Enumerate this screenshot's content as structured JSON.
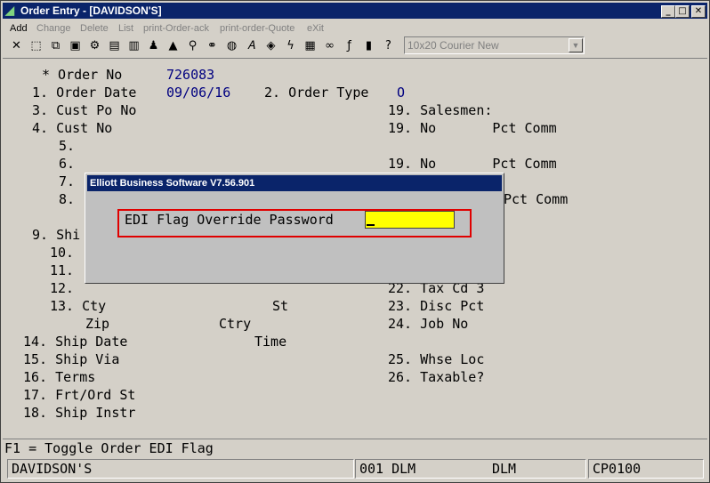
{
  "window": {
    "title": "Order Entry - [DAVIDSON'S]",
    "controls": {
      "minimize": "_",
      "maximize": "□",
      "close": "✕"
    }
  },
  "menu": [
    {
      "label": "Add",
      "enabled": true
    },
    {
      "label": "Change",
      "enabled": false
    },
    {
      "label": "Delete",
      "enabled": false
    },
    {
      "label": "List",
      "enabled": false
    },
    {
      "label": "print-Order-ack",
      "enabled": false
    },
    {
      "label": "print-order-Quote",
      "enabled": false
    },
    {
      "label": "eXit",
      "enabled": false
    }
  ],
  "toolbar": {
    "icons": [
      "close-icon",
      "select-icon",
      "copy-icon",
      "paste-icon",
      "gear-icon",
      "settings-icon",
      "note-icon",
      "user-icon",
      "alert-icon",
      "search-icon",
      "binoculars-icon",
      "globe-icon",
      "font-icon",
      "macro-icon",
      "lightning-icon",
      "calculator-icon",
      "link-icon",
      "function-icon",
      "report-icon",
      "help-icon"
    ],
    "font_select": "10x20 Courier New"
  },
  "form": {
    "order_no_label": "* Order No",
    "order_no_value": "726083",
    "order_date_label": "1. Order Date",
    "order_date_value": "09/06/16",
    "order_type_label": "2. Order Type",
    "order_type_value": "O",
    "cust_po_label": "3. Cust Po No",
    "cust_no_label": "4. Cust No",
    "f5": "5.",
    "f6": "6.",
    "f7": "7.",
    "f8": "8.",
    "f9": "9. Shi",
    "f10": "10.",
    "f11": "11.",
    "f12": "12.",
    "city_label": "13. Cty",
    "st_label": "St",
    "zip_label": "Zip",
    "ctry_label": "Ctry",
    "ship_date_label": "14. Ship Date",
    "time_label": "Time",
    "ship_via_label": "15. Ship Via",
    "terms_label": "16. Terms",
    "frt_label": "17. Frt/Ord St",
    "ship_instr_label": "18. Ship Instr",
    "salesmen_label": "19. Salesmen:",
    "sales_row1": "19. No       Pct Comm",
    "sales_row2": "19. No       Pct Comm",
    "sales_row3_partial": "Pct Comm",
    "tax_cd3": "22. Tax Cd 3",
    "disc_pct": "23. Disc Pct",
    "job_no": "24. Job No",
    "whse_loc": "25. Whse Loc",
    "taxable": "26. Taxable?"
  },
  "dialog": {
    "title": "Elliott Business Software V7.56.901",
    "prompt": "EDI Flag Override Password",
    "password_value": ""
  },
  "function_key_hint": "F1 = Toggle Order EDI Flag",
  "status_bar": {
    "company": "DAVIDSON'S",
    "code": "001 DLM",
    "user": "DLM",
    "terminal": "CP0100"
  }
}
